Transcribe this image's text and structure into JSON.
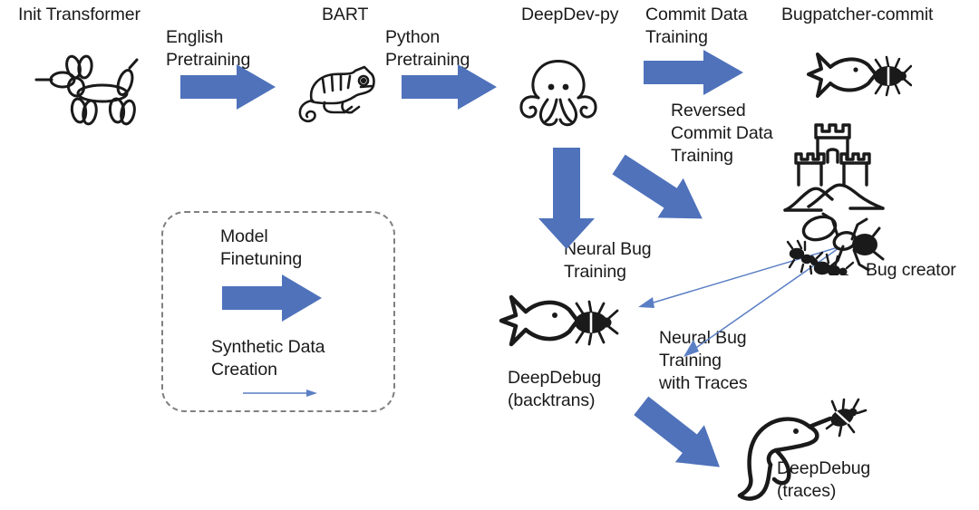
{
  "diagram": {
    "title_text_color": "#1a1a1a",
    "accent_blue": "#4F72BB",
    "thin_arrow_blue": "#5B7FC4",
    "legend_border_color": "#808080",
    "icon_color": "#1a1a1a",
    "nodes": [
      {
        "id": "init-transformer",
        "label": "Init Transformer",
        "icon": "balloon-dog-icon"
      },
      {
        "id": "bart",
        "label": "BART",
        "icon": "chameleon-icon"
      },
      {
        "id": "deepdev-py",
        "label": "DeepDev-py",
        "icon": "octopus-icon"
      },
      {
        "id": "bugpatcher-commit",
        "label": "Bugpatcher-commit",
        "icon": "fish-with-bug-icon"
      },
      {
        "id": "bug-creator",
        "label": "Bug creator",
        "icon": "castle-mountains-ants-icon"
      },
      {
        "id": "deepdebug-backtrans",
        "label": "DeepDebug\n(backtrans)",
        "icon": "fish-with-bug-icon"
      },
      {
        "id": "deepdebug-traces",
        "label": "DeepDebug\n(traces)",
        "icon": "dolphin-with-bug-icon"
      }
    ],
    "edges": [
      {
        "id": "english-pretraining",
        "label": "English\nPretraining",
        "style": "thick-blue-arrow",
        "direction": "right"
      },
      {
        "id": "python-pretraining",
        "label": "Python\nPretraining",
        "style": "thick-blue-arrow",
        "direction": "right"
      },
      {
        "id": "commit-data-training",
        "label": "Commit Data\nTraining",
        "style": "thick-blue-arrow",
        "direction": "right"
      },
      {
        "id": "reversed-commit-data-training",
        "label": "Reversed\nCommit Data\nTraining",
        "style": "thick-blue-arrow",
        "direction": "down-right"
      },
      {
        "id": "neural-bug-training",
        "label": "Neural Bug\nTraining",
        "style": "thick-blue-arrow",
        "direction": "down"
      },
      {
        "id": "neural-bug-training-with-traces",
        "label": "Neural Bug\nTraining\nwith Traces",
        "style": "thick-blue-arrow",
        "direction": "down-right"
      },
      {
        "id": "bug-creator-to-backtrans",
        "label": "",
        "style": "thin-blue-arrow",
        "direction": "down-left"
      },
      {
        "id": "bug-creator-to-traces",
        "label": "",
        "style": "thin-blue-arrow",
        "direction": "down-left"
      }
    ],
    "legend": {
      "finetuning_label": "Model\nFinetuning",
      "finetuning_arrow_style": "thick-blue-arrow",
      "synthetic_label": "Synthetic Data\nCreation",
      "synthetic_arrow_style": "thin-blue-arrow"
    }
  }
}
